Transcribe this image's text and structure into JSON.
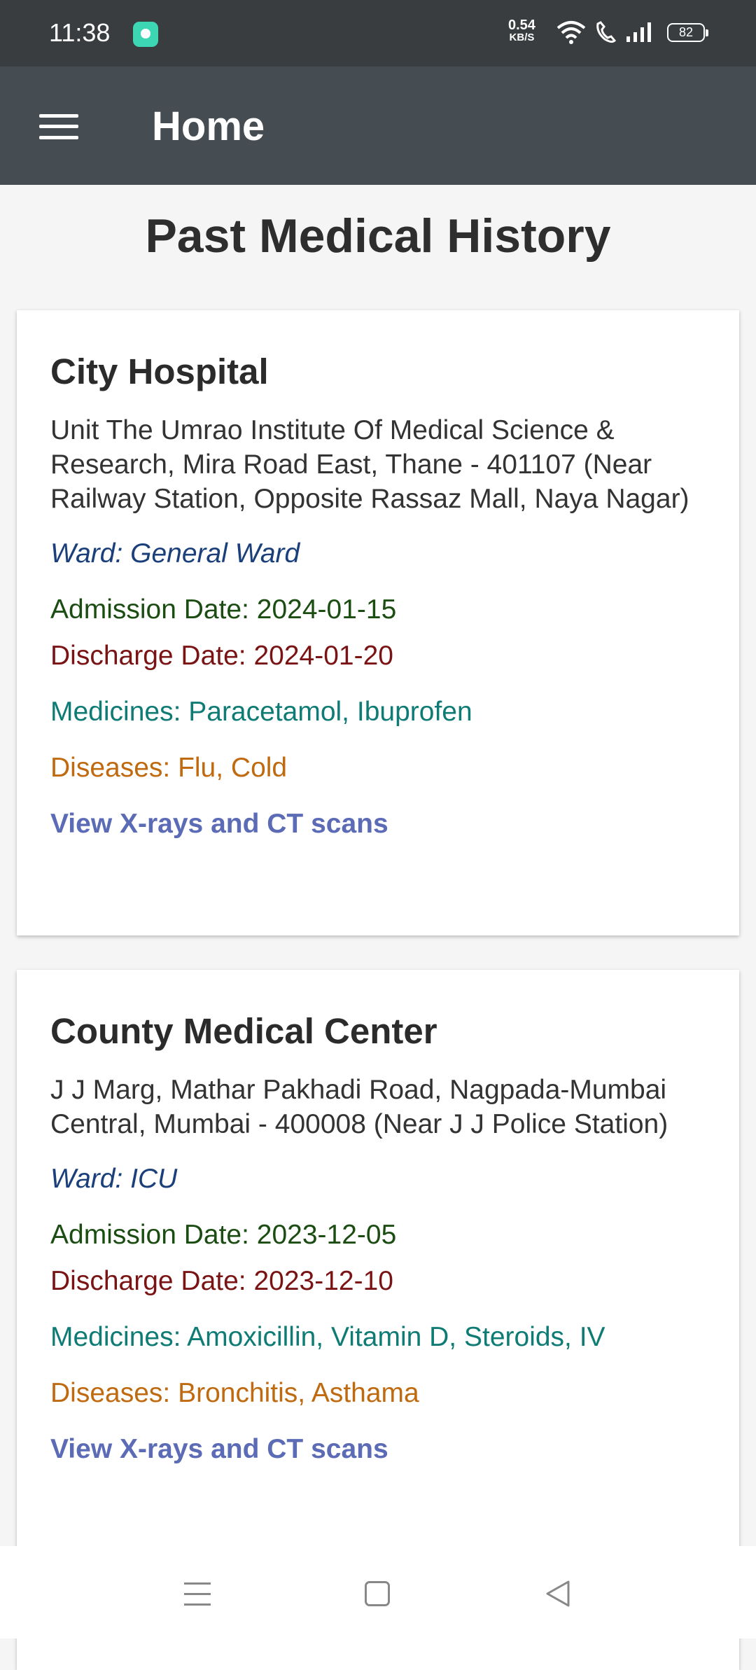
{
  "status_bar": {
    "time": "11:38",
    "net_speed": "0.54",
    "net_unit": "KB/S",
    "battery": "82"
  },
  "app_bar": {
    "title": "Home",
    "menu_icon": "hamburger-icon"
  },
  "page": {
    "title": "Past Medical History"
  },
  "records": [
    {
      "hospital": "City Hospital",
      "address": "Unit The Umrao Institute Of Medical Science & Research, Mira Road East, Thane - 401107 (Near Railway Station, Opposite Rassaz Mall, Naya Nagar)",
      "ward": "Ward: General Ward",
      "admission": "Admission Date: 2024-01-15",
      "discharge": "Discharge Date: 2024-01-20",
      "medicines": "Medicines: Paracetamol, Ibuprofen",
      "diseases": "Diseases: Flu, Cold",
      "link": "View X-rays and CT scans"
    },
    {
      "hospital": "County Medical Center",
      "address": "J J Marg, Mathar Pakhadi Road, Nagpada-Mumbai Central, Mumbai - 400008 (Near J J Police Station)",
      "ward": "Ward: ICU",
      "admission": "Admission Date: 2023-12-05",
      "discharge": "Discharge Date: 2023-12-10",
      "medicines": "Medicines: Amoxicillin, Vitamin D, Steroids, IV",
      "diseases": "Diseases: Bronchitis, Asthama",
      "link": "View X-rays and CT scans"
    }
  ],
  "colors": {
    "app_bar": "#464d52",
    "ward": "#1a3f7a",
    "admission": "#1b4d12",
    "discharge": "#7a1414",
    "medicines": "#0e7b74",
    "diseases": "#c06a10",
    "link": "#5c6bb5"
  },
  "nav_bar": {
    "icons": [
      "recents-icon",
      "home-icon",
      "back-icon"
    ]
  }
}
